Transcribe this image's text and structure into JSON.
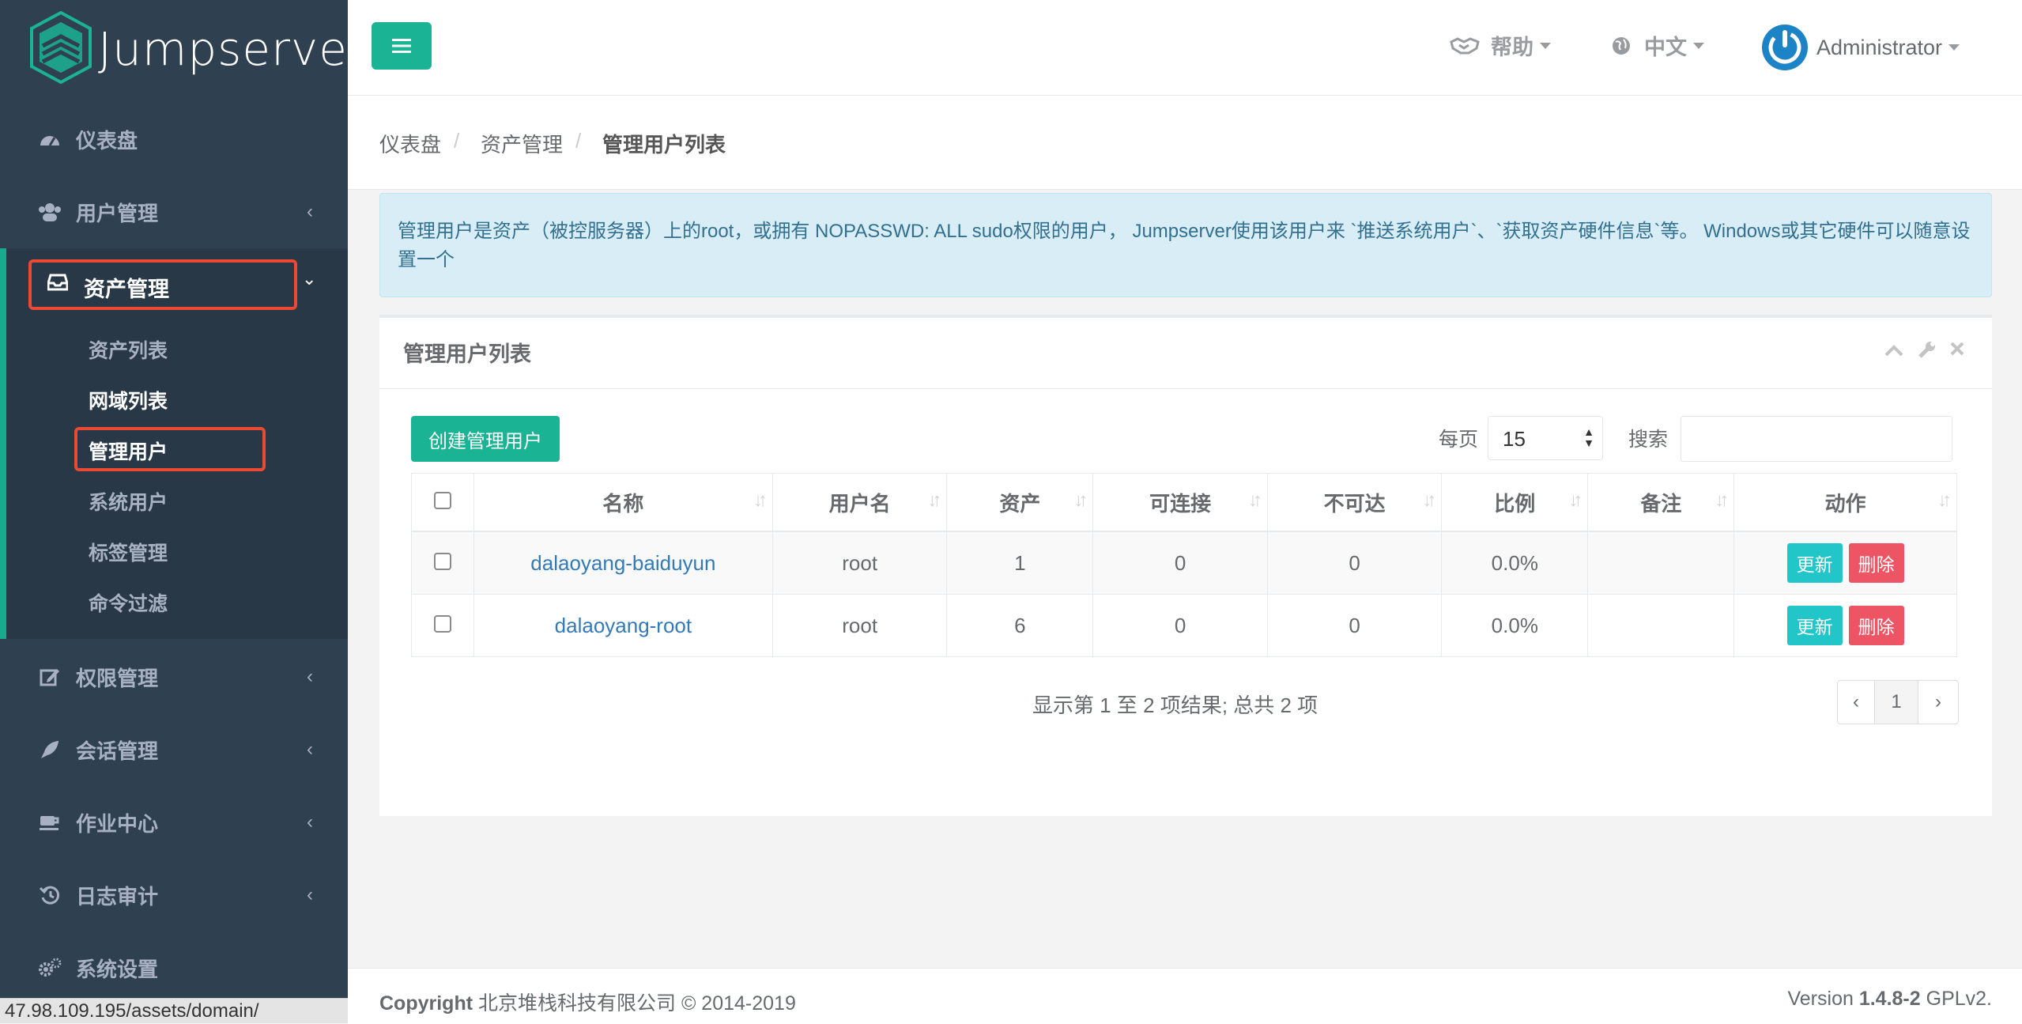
{
  "app": {
    "logo_text": "Jumpserver"
  },
  "sidebar": {
    "items": [
      {
        "label": "仪表盘",
        "icon": "dashboard-icon"
      },
      {
        "label": "用户管理",
        "icon": "users-icon"
      },
      {
        "label": "资产管理",
        "icon": "inbox-icon"
      },
      {
        "label": "权限管理",
        "icon": "edit-icon"
      },
      {
        "label": "会话管理",
        "icon": "rocket-icon"
      },
      {
        "label": "作业中心",
        "icon": "coffee-icon"
      },
      {
        "label": "日志审计",
        "icon": "history-icon"
      },
      {
        "label": "系统设置",
        "icon": "cogs-icon"
      }
    ],
    "subitems": [
      "资产列表",
      "网域列表",
      "管理用户",
      "系统用户",
      "标签管理",
      "命令过滤"
    ],
    "chevron_left": "‹",
    "chevron_down": "⌄"
  },
  "status_url": "47.98.109.195/assets/domain/",
  "topbar": {
    "help": "帮助",
    "lang": "中文",
    "user": "Administrator"
  },
  "breadcrumb": [
    "仪表盘",
    "资产管理",
    "管理用户列表"
  ],
  "breadcrumb_sep": "/",
  "alert": "管理用户是资产（被控服务器）上的root，或拥有 NOPASSWD: ALL sudo权限的用户， Jumpserver使用该用户来 `推送系统用户`、`获取资产硬件信息`等。 Windows或其它硬件可以随意设置一个",
  "panel": {
    "title": "管理用户列表",
    "create_button": "创建管理用户",
    "per_page_label": "每页",
    "per_page_value": "15",
    "search_label": "搜索",
    "search_value": ""
  },
  "table": {
    "headers": [
      "名称",
      "用户名",
      "资产",
      "可连接",
      "不可达",
      "比例",
      "备注",
      "动作"
    ],
    "rows": [
      {
        "name": "dalaoyang-baiduyun",
        "username": "root",
        "assets": "1",
        "reachable": "0",
        "unreachable": "0",
        "ratio": "0.0%",
        "comment": ""
      },
      {
        "name": "dalaoyang-root",
        "username": "root",
        "assets": "6",
        "reachable": "0",
        "unreachable": "0",
        "ratio": "0.0%",
        "comment": ""
      }
    ],
    "update_label": "更新",
    "delete_label": "删除"
  },
  "table_info": "显示第 1 至 2 项结果; 总共 2 项",
  "pagination": {
    "prev": "‹",
    "page": "1",
    "next": "›"
  },
  "footer": {
    "copyright_bold": "Copyright",
    "copyright_rest": " 北京堆栈科技有限公司 © 2014-2019",
    "version_prefix": "Version ",
    "version": "1.4.8-2",
    "license": " GPLv2."
  },
  "colors": {
    "sidebar_bg": "#2f4050",
    "accent": "#1ab394",
    "highlight_box": "#ea4a34",
    "info_btn": "#23c6c8",
    "danger": "#ed5565"
  }
}
